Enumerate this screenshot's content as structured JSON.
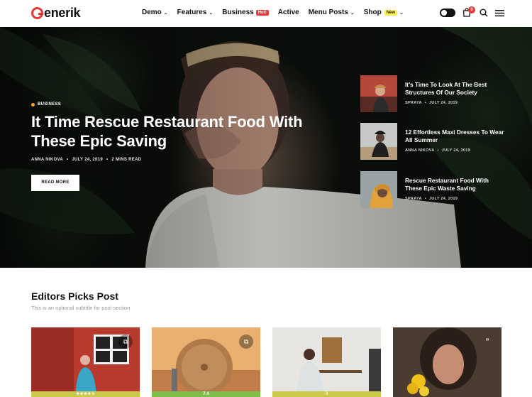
{
  "header": {
    "logo": "enerik",
    "nav": [
      {
        "label": "Demo",
        "dropdown": true
      },
      {
        "label": "Features",
        "dropdown": true
      },
      {
        "label": "Business",
        "badge": "Hot!",
        "dropdown": false
      },
      {
        "label": "Active",
        "dropdown": false
      },
      {
        "label": "Menu Posts",
        "dropdown": true
      },
      {
        "label": "Shop",
        "badge": "New",
        "dropdown": true
      }
    ],
    "cart_count": "0"
  },
  "hero": {
    "category": "BUSINESS",
    "title": "It Time Rescue Restaurant Food With These Epic Saving",
    "author": "ANNA NIKOVA",
    "date": "JULY 24, 2019",
    "read_time": "2 MINS READ",
    "button": "READ MORE",
    "side_posts": [
      {
        "title": "It's Time To Look At The Best Structures Of Our Society",
        "author": "SPRAYA",
        "date": "JULY 24, 2019"
      },
      {
        "title": "12 Effortless Maxi Dresses To Wear All Summer",
        "author": "ANNA NIKOVA",
        "date": "JULY 24, 2019"
      },
      {
        "title": "Rescue Restaurant Food With These Epic Waste Saving",
        "author": "SPRAYA",
        "date": "JULY 24, 2019"
      }
    ]
  },
  "editors": {
    "title": "Editors Picks Post",
    "subtitle": "This is an optional subtitle for post section",
    "cards": [
      {
        "score": "★★★★☆",
        "bar_color": "#c9c94a",
        "icon": "gallery-icon"
      },
      {
        "score": "7.4",
        "bar_color": "#7cbf4a",
        "icon": "gallery-icon"
      },
      {
        "score": "6",
        "bar_color": "#c9c94a",
        "icon": "none"
      },
      {
        "score": "",
        "bar_color": "",
        "icon": "quote-icon"
      }
    ]
  },
  "colors": {
    "accent": "#e53935",
    "category_dot": "#f5a623",
    "new_badge": "#ffee58"
  }
}
